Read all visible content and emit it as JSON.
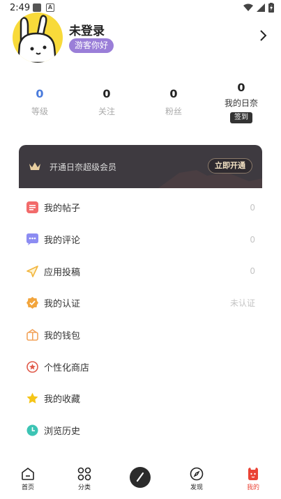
{
  "status_bar": {
    "time": "2:49",
    "icons": [
      "notification-square-icon",
      "a-icon",
      "wifi-icon",
      "signal-icon",
      "battery-charging-icon"
    ]
  },
  "profile": {
    "name": "未登录",
    "badge": "游客你好",
    "avatar": "rabbit-avatar"
  },
  "stats": [
    {
      "value": "0",
      "label": "等级",
      "color": "#4a7bdc"
    },
    {
      "value": "0",
      "label": "关注",
      "color": "#222222"
    },
    {
      "value": "0",
      "label": "粉丝",
      "color": "#222222"
    },
    {
      "value": "0",
      "label": "我的日奈",
      "button": "签到",
      "color": "#222222"
    }
  ],
  "vip_banner": {
    "icon": "crown-icon",
    "text": "开通日奈超级会员",
    "button": "立即开通"
  },
  "menu": [
    {
      "label": "我的帖子",
      "value": "0",
      "icon": "posts-icon",
      "color": "#f26b6b"
    },
    {
      "label": "我的评论",
      "value": "0",
      "icon": "comment-icon",
      "color": "#8c8cf2"
    },
    {
      "label": "应用投稿",
      "value": "0",
      "icon": "submit-icon",
      "color": "#f2b53d"
    },
    {
      "label": "我的认证",
      "value": "未认证",
      "icon": "verified-icon",
      "color": "#f2a53d"
    },
    {
      "label": "我的钱包",
      "value": "",
      "icon": "wallet-icon",
      "color": "#f2a35a"
    },
    {
      "label": "个性化商店",
      "value": "",
      "icon": "store-icon",
      "color": "#e05a4a"
    },
    {
      "label": "我的收藏",
      "value": "",
      "icon": "star-icon",
      "color": "#f5c518"
    },
    {
      "label": "浏览历史",
      "value": "",
      "icon": "history-icon",
      "color": "#3cc4b4"
    }
  ],
  "bottom_nav": {
    "items": [
      {
        "label": "首页",
        "icon": "home-icon",
        "active": false
      },
      {
        "label": "分类",
        "icon": "category-icon",
        "active": false
      },
      {
        "label": "发现",
        "icon": "compass-icon",
        "active": false
      },
      {
        "label": "我的",
        "icon": "profile-icon",
        "active": true
      }
    ],
    "compose_icon": "pen-icon",
    "active_color": "#ea4335"
  }
}
